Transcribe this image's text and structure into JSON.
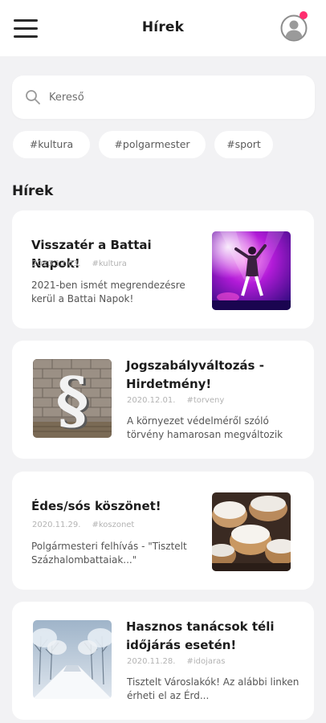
{
  "header": {
    "title": "Hírek",
    "menu_icon": "hamburger-icon",
    "avatar_icon": "user-avatar-icon",
    "notification_color": "#ff2d6f"
  },
  "search": {
    "placeholder": "Kereső",
    "value": ""
  },
  "tags": [
    "#kultura",
    "#polgarmester",
    "#sport"
  ],
  "section_title": "Hírek",
  "news": [
    {
      "title": "Visszatér a Battai Napok!",
      "date": "2020.12.03.",
      "tag": "#kultura",
      "description": "2021-ben ismét megrendezésre kerül a Battai Napok!",
      "image": "concert-image"
    },
    {
      "title": "Jogszabályváltozás - Hirdetmény!",
      "date": "2020.12.01.",
      "tag": "#torveny",
      "description": "A környezet védelméről szóló törvény hamarosan megváltozik",
      "image": "paragraph-sign-image"
    },
    {
      "title": "Édes/sós köszönet!",
      "date": "2020.11.29.",
      "tag": "#koszonet",
      "description": "Polgármesteri felhívás - \"Tisztelt Százhalombattaiak...\"",
      "image": "pastries-image"
    },
    {
      "title": "Hasznos tanácsok téli időjárás esetén!",
      "date": "2020.11.28.",
      "tag": "#idojaras",
      "description": "Tisztelt Városlakók! Az alábbi linken érheti el az Érd...",
      "image": "winter-road-image"
    }
  ]
}
